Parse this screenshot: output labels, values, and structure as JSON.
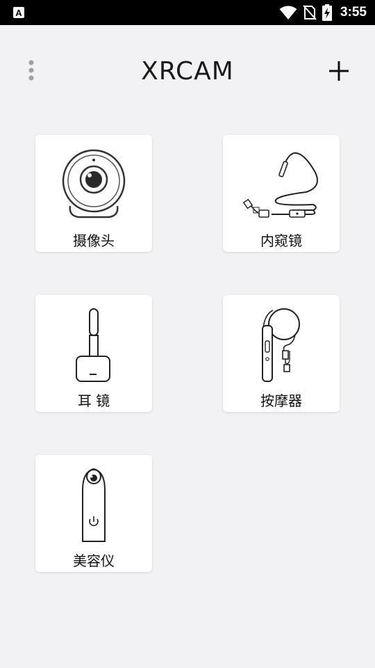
{
  "status_bar": {
    "time": "3:55",
    "icons": [
      "notification-a-icon",
      "wifi-icon",
      "no-sim-icon",
      "battery-charging-icon"
    ]
  },
  "header": {
    "title": "XRCAM",
    "menu_icon": "more-vert-icon",
    "add_icon": "plus-icon"
  },
  "devices": [
    {
      "label": "摄像头",
      "icon": "webcam-icon"
    },
    {
      "label": "内窥镜",
      "icon": "endoscope-icon"
    },
    {
      "label": "耳 镜",
      "icon": "otoscope-icon"
    },
    {
      "label": "按摩器",
      "icon": "massager-icon"
    },
    {
      "label": "美容仪",
      "icon": "beauty-device-icon"
    }
  ]
}
